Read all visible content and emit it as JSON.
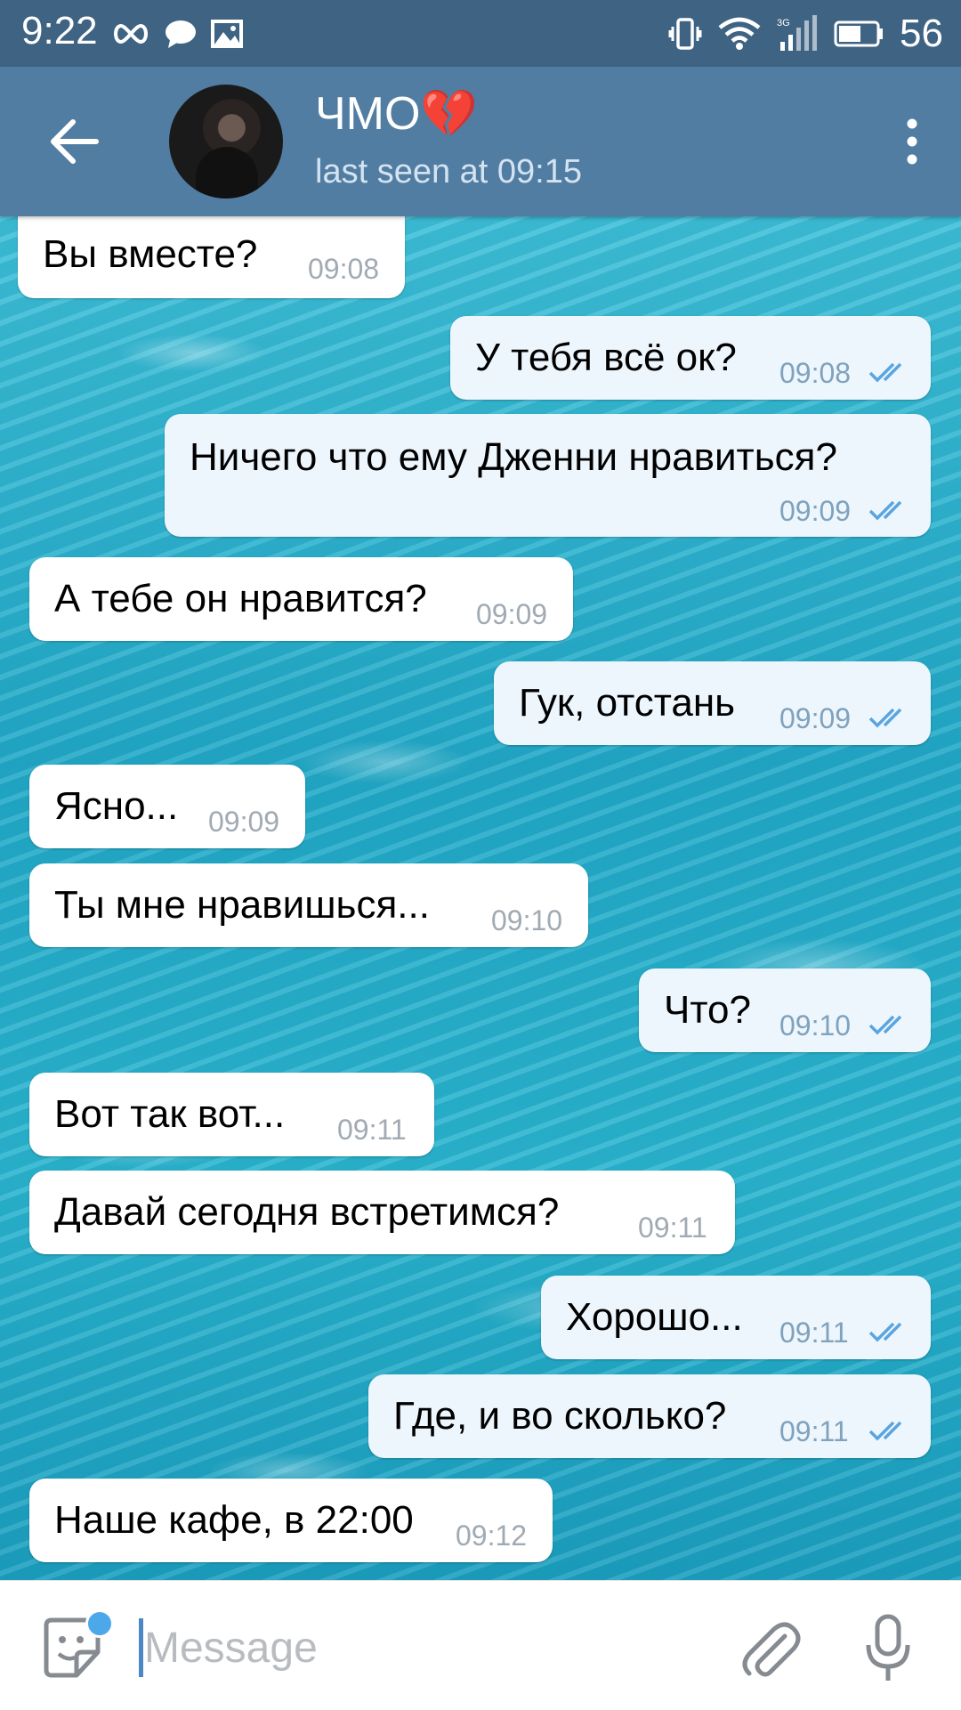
{
  "status_bar": {
    "time": "9:22",
    "battery": "56",
    "network": "3G",
    "left_icons": [
      "infinity-icon",
      "chat-bubble-icon",
      "image-icon"
    ],
    "right_icons": [
      "vibrate-icon",
      "wifi-icon",
      "signal-icon",
      "battery-icon"
    ]
  },
  "header": {
    "title": "ЧМО💔",
    "status": "last seen at 09:15"
  },
  "messages": [
    {
      "dir": "in",
      "text": "Вы вместе?",
      "time": "09:08"
    },
    {
      "dir": "out",
      "text": "У тебя всё ок?",
      "time": "09:08"
    },
    {
      "dir": "out",
      "text": "Ничего что ему Дженни нравиться?",
      "time": "09:09"
    },
    {
      "dir": "in",
      "text": "А тебе он нравится?",
      "time": "09:09"
    },
    {
      "dir": "out",
      "text": "Гук, отстань",
      "time": "09:09"
    },
    {
      "dir": "in",
      "text": "Ясно...",
      "time": "09:09"
    },
    {
      "dir": "in",
      "text": "Ты мне нравишься...",
      "time": "09:10"
    },
    {
      "dir": "out",
      "text": "Что?",
      "time": "09:10"
    },
    {
      "dir": "in",
      "text": "Вот так вот...",
      "time": "09:11"
    },
    {
      "dir": "in",
      "text": "Давай сегодня встретимся?",
      "time": "09:11"
    },
    {
      "dir": "out",
      "text": "Хорошо...",
      "time": "09:11"
    },
    {
      "dir": "out",
      "text": "Где, и во сколько?",
      "time": "09:11"
    },
    {
      "dir": "in",
      "text": "Наше кафе, в 22:00",
      "time": "09:12"
    }
  ],
  "input": {
    "placeholder": "Message"
  },
  "colors": {
    "status_bar": "#3f6383",
    "header": "#517da2",
    "outgoing_bubble": "#eef6fd",
    "incoming_bubble": "#ffffff",
    "read_check": "#5aa5df"
  }
}
